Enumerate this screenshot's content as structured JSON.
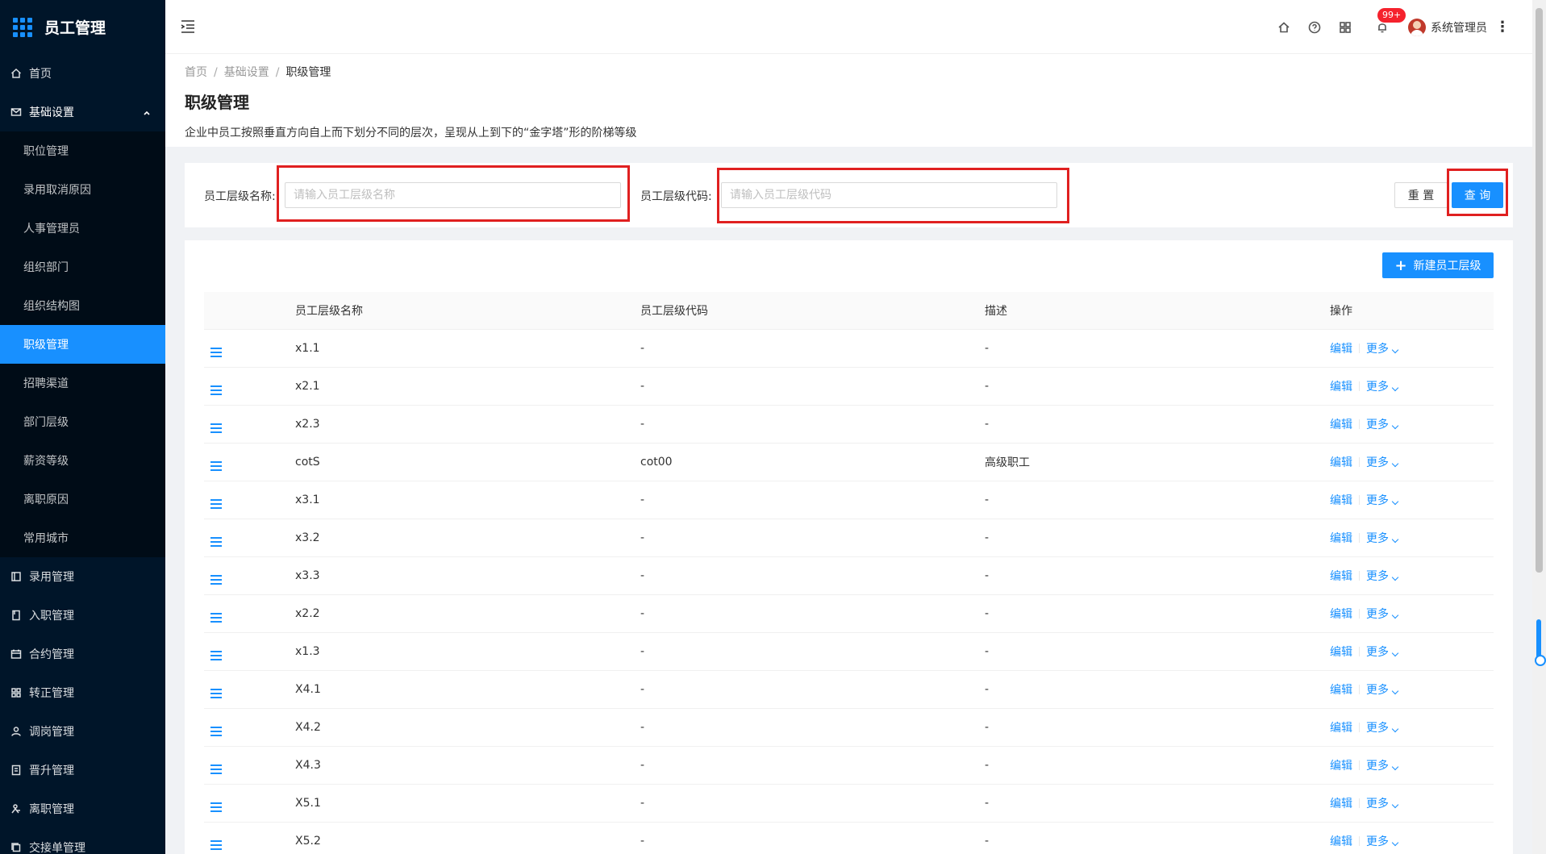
{
  "app": {
    "title": "员工管理"
  },
  "sidebar": {
    "items": [
      {
        "label": "首页",
        "icon": "home-icon"
      },
      {
        "label": "基础设置",
        "icon": "mail-icon",
        "open": true
      },
      {
        "label": "录用管理",
        "icon": "calendar-icon"
      },
      {
        "label": "入职管理",
        "icon": "book-icon"
      },
      {
        "label": "合约管理",
        "icon": "schedule-icon"
      },
      {
        "label": "转正管理",
        "icon": "team-icon"
      },
      {
        "label": "调岗管理",
        "icon": "user-icon"
      },
      {
        "label": "晋升管理",
        "icon": "file-icon"
      },
      {
        "label": "离职管理",
        "icon": "exit-icon"
      },
      {
        "label": "交接单管理",
        "icon": "copy-icon"
      }
    ],
    "sub_items": [
      {
        "label": "职位管理"
      },
      {
        "label": "录用取消原因"
      },
      {
        "label": "人事管理员"
      },
      {
        "label": "组织部门"
      },
      {
        "label": "组织结构图"
      },
      {
        "label": "职级管理",
        "active": true
      },
      {
        "label": "招聘渠道"
      },
      {
        "label": "部门层级"
      },
      {
        "label": "薪资等级"
      },
      {
        "label": "离职原因"
      },
      {
        "label": "常用城市"
      }
    ]
  },
  "header": {
    "notification_count": "99+",
    "user_name": "系统管理员",
    "icons": [
      "home-icon",
      "question-icon",
      "apps-icon",
      "bell-icon"
    ]
  },
  "breadcrumb": {
    "items": [
      "首页",
      "基础设置",
      "职级管理"
    ],
    "separator": "/"
  },
  "page": {
    "title": "职级管理",
    "description": "企业中员工按照垂直方向自上而下划分不同的层次，呈现从上到下的“金字塔”形的阶梯等级"
  },
  "search": {
    "name_label": "员工层级名称:",
    "name_placeholder": "请输入员工层级名称",
    "code_label": "员工层级代码:",
    "code_placeholder": "请输入员工层级代码",
    "reset_label": "重 置",
    "query_label": "查 询"
  },
  "table": {
    "new_button_label": "新建员工层级",
    "columns": [
      "员工层级名称",
      "员工层级代码",
      "描述",
      "操作"
    ],
    "edit_label": "编辑",
    "more_label": "更多",
    "rows": [
      {
        "name": "x1.1",
        "code": "-",
        "desc": "-"
      },
      {
        "name": "x2.1",
        "code": "-",
        "desc": "-"
      },
      {
        "name": "x2.3",
        "code": "-",
        "desc": "-"
      },
      {
        "name": "cotS",
        "code": "cot00",
        "desc": "高级职工"
      },
      {
        "name": "x3.1",
        "code": "-",
        "desc": "-"
      },
      {
        "name": "x3.2",
        "code": "-",
        "desc": "-"
      },
      {
        "name": "x3.3",
        "code": "-",
        "desc": "-"
      },
      {
        "name": "x2.2",
        "code": "-",
        "desc": "-"
      },
      {
        "name": "x1.3",
        "code": "-",
        "desc": "-"
      },
      {
        "name": "X4.1",
        "code": "-",
        "desc": "-"
      },
      {
        "name": "X4.2",
        "code": "-",
        "desc": "-"
      },
      {
        "name": "X4.3",
        "code": "-",
        "desc": "-"
      },
      {
        "name": "X5.1",
        "code": "-",
        "desc": "-"
      },
      {
        "name": "X5.2",
        "code": "-",
        "desc": "-"
      }
    ]
  },
  "colors": {
    "accent": "#1890ff",
    "sidebar_bg": "#001529",
    "submenu_bg": "#000c17",
    "highlight_box": "#e02020",
    "badge": "#f5222d"
  }
}
